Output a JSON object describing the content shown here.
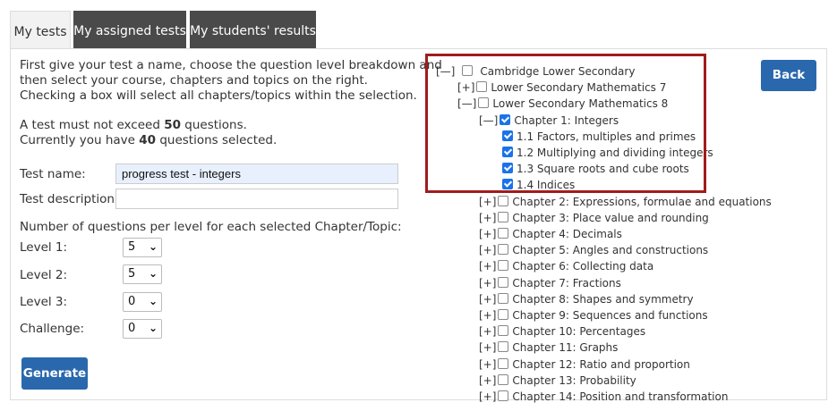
{
  "tabs": [
    "My tests",
    "My assigned tests",
    "My students' results"
  ],
  "intro": {
    "line1": "First give your test a name, choose the question level breakdown and",
    "line2": "then select your course, chapters and topics on the right.",
    "line3": "Checking a box will select all chapters/topics within the selection.",
    "limit_prefix": "A test must not exceed ",
    "limit_value": "50",
    "limit_suffix": " questions.",
    "current_prefix": "Currently you have ",
    "current_value": "40",
    "current_suffix": " questions selected."
  },
  "form": {
    "name_label": "Test name:",
    "name_value": "progress test - integers",
    "desc_label": "Test description:",
    "desc_value": "",
    "levels_heading": "Number of questions per level for each selected Chapter/Topic:",
    "levels": [
      {
        "label": "Level 1:",
        "value": "5"
      },
      {
        "label": "Level 2:",
        "value": "5"
      },
      {
        "label": "Level 3:",
        "value": "0"
      },
      {
        "label": "Challenge:",
        "value": "0"
      }
    ],
    "generate": "Generate"
  },
  "back": "Back",
  "tree": [
    {
      "toggle": "[—]",
      "label": "Cambridge Lower Secondary",
      "checked": false
    },
    {
      "toggle": "[+]",
      "label": "Lower Secondary Mathematics 7",
      "checked": false
    },
    {
      "toggle": "[—]",
      "label": "Lower Secondary Mathematics 8",
      "checked": false
    },
    {
      "toggle": "[—]",
      "label": "Chapter 1: Integers",
      "checked": true
    },
    {
      "toggle": "",
      "label": "1.1 Factors, multiples and primes",
      "checked": true
    },
    {
      "toggle": "",
      "label": "1.2 Multiplying and dividing integers",
      "checked": true
    },
    {
      "toggle": "",
      "label": "1.3 Square roots and cube roots",
      "checked": true
    },
    {
      "toggle": "",
      "label": "1.4 Indices",
      "checked": true
    },
    {
      "toggle": "[+]",
      "label": "Chapter 2: Expressions, formulae and equations",
      "checked": false
    },
    {
      "toggle": "[+]",
      "label": "Chapter 3: Place value and rounding",
      "checked": false
    },
    {
      "toggle": "[+]",
      "label": "Chapter 4: Decimals",
      "checked": false
    },
    {
      "toggle": "[+]",
      "label": "Chapter 5: Angles and constructions",
      "checked": false
    },
    {
      "toggle": "[+]",
      "label": "Chapter 6: Collecting data",
      "checked": false
    },
    {
      "toggle": "[+]",
      "label": "Chapter 7: Fractions",
      "checked": false
    },
    {
      "toggle": "[+]",
      "label": "Chapter 8: Shapes and symmetry",
      "checked": false
    },
    {
      "toggle": "[+]",
      "label": "Chapter 9: Sequences and functions",
      "checked": false
    },
    {
      "toggle": "[+]",
      "label": "Chapter 10: Percentages",
      "checked": false
    },
    {
      "toggle": "[+]",
      "label": "Chapter 11: Graphs",
      "checked": false
    },
    {
      "toggle": "[+]",
      "label": "Chapter 12: Ratio and proportion",
      "checked": false
    },
    {
      "toggle": "[+]",
      "label": "Chapter 13: Probability",
      "checked": false
    },
    {
      "toggle": "[+]",
      "label": "Chapter 14: Position and transformation",
      "checked": false
    }
  ],
  "colors": {
    "tab_dark": "#4a4a4a",
    "button": "#2a68ad",
    "highlight": "#a01c1c",
    "checkbox": "#1a73e8"
  }
}
